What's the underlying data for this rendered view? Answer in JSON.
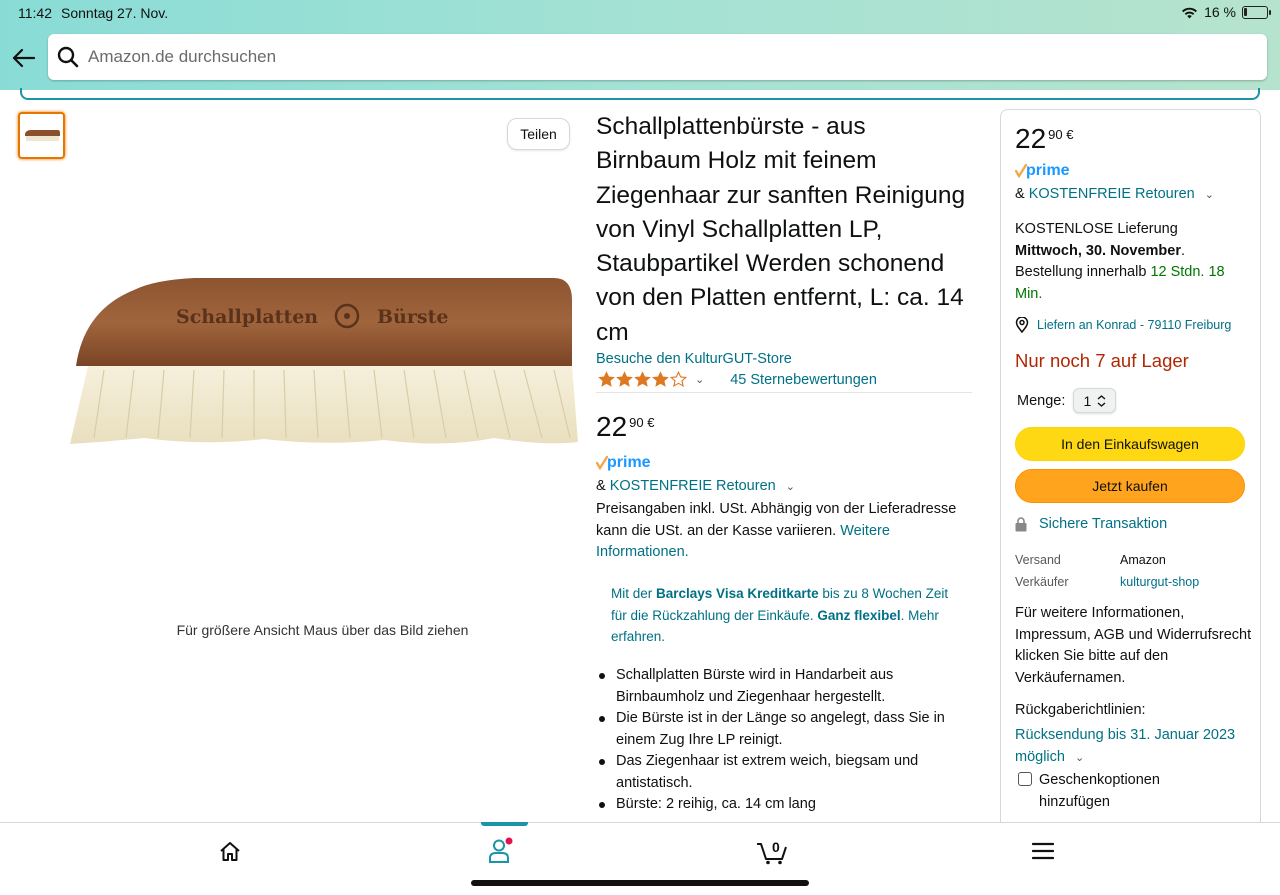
{
  "status_bar": {
    "time": "11:42",
    "date": "Sonntag 27. Nov.",
    "battery": "16 %"
  },
  "search": {
    "placeholder": "Amazon.de durchsuchen"
  },
  "gallery": {
    "share_label": "Teilen",
    "zoom_hint": "Für größere Ansicht Maus über das Bild ziehen",
    "brush_text_left": "Schallplatten",
    "brush_text_right": "Bürste"
  },
  "product": {
    "title": "Schallplattenbürste - aus Birnbaum Holz mit feinem Ziegenhaar zur sanften Reinigung von Vinyl Schallplatten LP, Staubpartikel Werden schonend von den Platten entfernt, L: ca. 14 cm",
    "store_link": "Besuche den KulturGUT-Store",
    "rating_stars": 4.5,
    "rating_count": "45 Sternebewertungen",
    "price_whole": "22",
    "price_fraction": "90 €",
    "prime_label": "prime",
    "returns_prefix": "& ",
    "returns_link": "KOSTENFREIE Retouren",
    "tax_text": "Preisangaben inkl. USt. Abhängig von der Lieferadresse kann die USt. an der Kasse variieren.",
    "tax_link": "Weitere Informationen.",
    "promo": {
      "p1": "Mit der ",
      "b1": "Barclays Visa Kreditkarte",
      "p2": " bis zu 8 Wochen Zeit für die Rückzahlung der Einkäufe. ",
      "b2": "Ganz flexibel",
      "p3": ". Mehr erfahren."
    },
    "bullets": [
      "Schallplatten Bürste wird in Handarbeit aus Birnbaumholz und Ziegenhaar hergestellt.",
      "Die Bürste ist in der Länge so angelegt, dass Sie in einem Zug Ihre LP reinigt.",
      "Das Ziegenhaar ist extrem weich, biegsam und antistatisch.",
      "Bürste: 2 reihig, ca. 14 cm lang"
    ]
  },
  "buybox": {
    "price_whole": "22",
    "price_fraction": "90 €",
    "prime_label": "prime",
    "returns_prefix": "& ",
    "returns_link": "KOSTENFREIE Retouren",
    "delivery_line1": "KOSTENLOSE Lieferung",
    "delivery_date": "Mittwoch, 30. November",
    "delivery_dot": ".",
    "order_within": "Bestellung innerhalb ",
    "order_time": "12 Stdn. 18 Min.",
    "location": "Liefern an Konrad - 79110 Freiburg",
    "stock": "Nur noch 7 auf Lager",
    "qty_label": "Menge:",
    "qty_value": "1",
    "add_to_cart": "In den Einkaufswagen",
    "buy_now": "Jetzt kaufen",
    "secure": "Sichere Transaktion",
    "ship_label": "Versand",
    "ship_value": "Amazon",
    "seller_label": "Verkäufer",
    "seller_value": "kulturgut-shop",
    "info": "Für weitere Informationen, Impressum, AGB und Widerrufsrecht klicken Sie bitte auf den Verkäufernamen.",
    "return_heading": "Rückgaberichtlinien:",
    "return_link": "Rücksendung bis 31. Januar 2023 möglich",
    "gift": "Geschenkoptionen hinzufügen"
  },
  "bottom_nav": {
    "cart_count": "0"
  },
  "colors": {
    "accent": "#1a95a8",
    "link": "#007185",
    "stock": "#b12704",
    "cart_btn": "#ffd814",
    "buy_btn": "#ffa41c",
    "star": "#de7921"
  }
}
